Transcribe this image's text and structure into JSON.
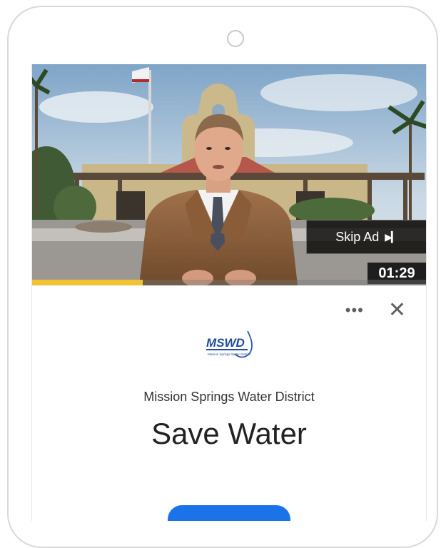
{
  "ad": {
    "skip_label": "Skip Ad",
    "skip_icon": "▶▎",
    "timer": "01:29",
    "progress": 0.28,
    "progress_color": "#f2c232"
  },
  "card": {
    "more_icon": "•••",
    "close_icon": "✕",
    "logo_text": "MSWD",
    "logo_subtext": "Mission Springs Water District",
    "advertiser": "Mission Springs Water District",
    "headline": "Save Water",
    "cta_color": "#1a73e8"
  }
}
